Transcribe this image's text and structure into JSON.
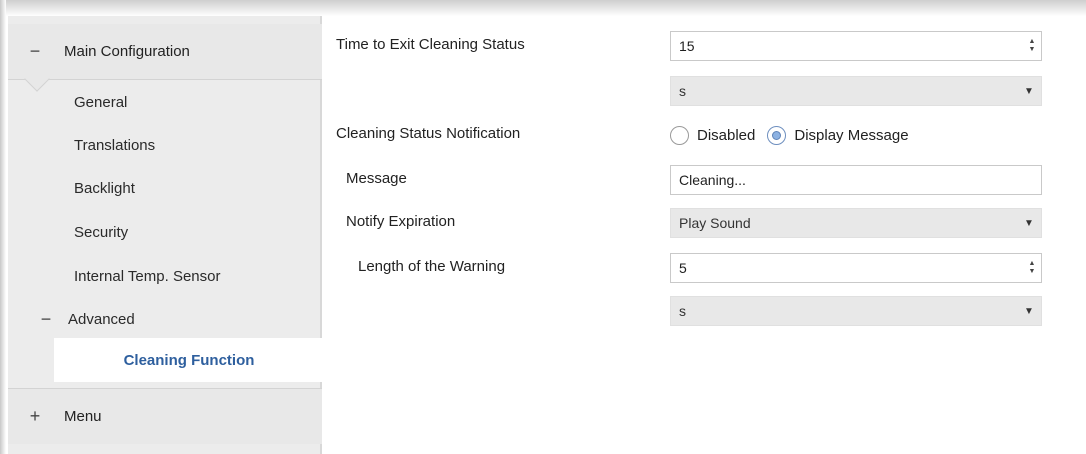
{
  "sidebar": {
    "main_section": {
      "sign": "−",
      "label": "Main Configuration"
    },
    "items": [
      {
        "label": "General"
      },
      {
        "label": "Translations"
      },
      {
        "label": "Backlight"
      },
      {
        "label": "Security"
      },
      {
        "label": "Internal Temp. Sensor"
      }
    ],
    "advanced": {
      "sign": "−",
      "label": "Advanced"
    },
    "active_item": {
      "label": "Cleaning Function"
    },
    "menu_section": {
      "sign": "+",
      "label": "Menu"
    }
  },
  "form": {
    "time_to_exit": {
      "label": "Time to Exit Cleaning Status",
      "value": "15",
      "unit": "s"
    },
    "notification": {
      "label": "Cleaning Status Notification",
      "options": [
        "Disabled",
        "Display Message"
      ],
      "selected": "Display Message"
    },
    "message": {
      "label": "Message",
      "value": "Cleaning..."
    },
    "notify_expiration": {
      "label": "Notify Expiration",
      "value": "Play Sound"
    },
    "warning_length": {
      "label": "Length of the Warning",
      "value": "5",
      "unit": "s"
    }
  },
  "colors": {
    "active_item_text": "#2e5f9e",
    "sidebar_bg": "#ececec",
    "select_bg": "#e8e8e8",
    "radio_checked": "#8db2e2"
  },
  "icons": {
    "collapse": "minus-icon",
    "expand": "plus-icon",
    "spinner": "spinner-arrows-icon",
    "dropdown": "caret-down-icon"
  }
}
